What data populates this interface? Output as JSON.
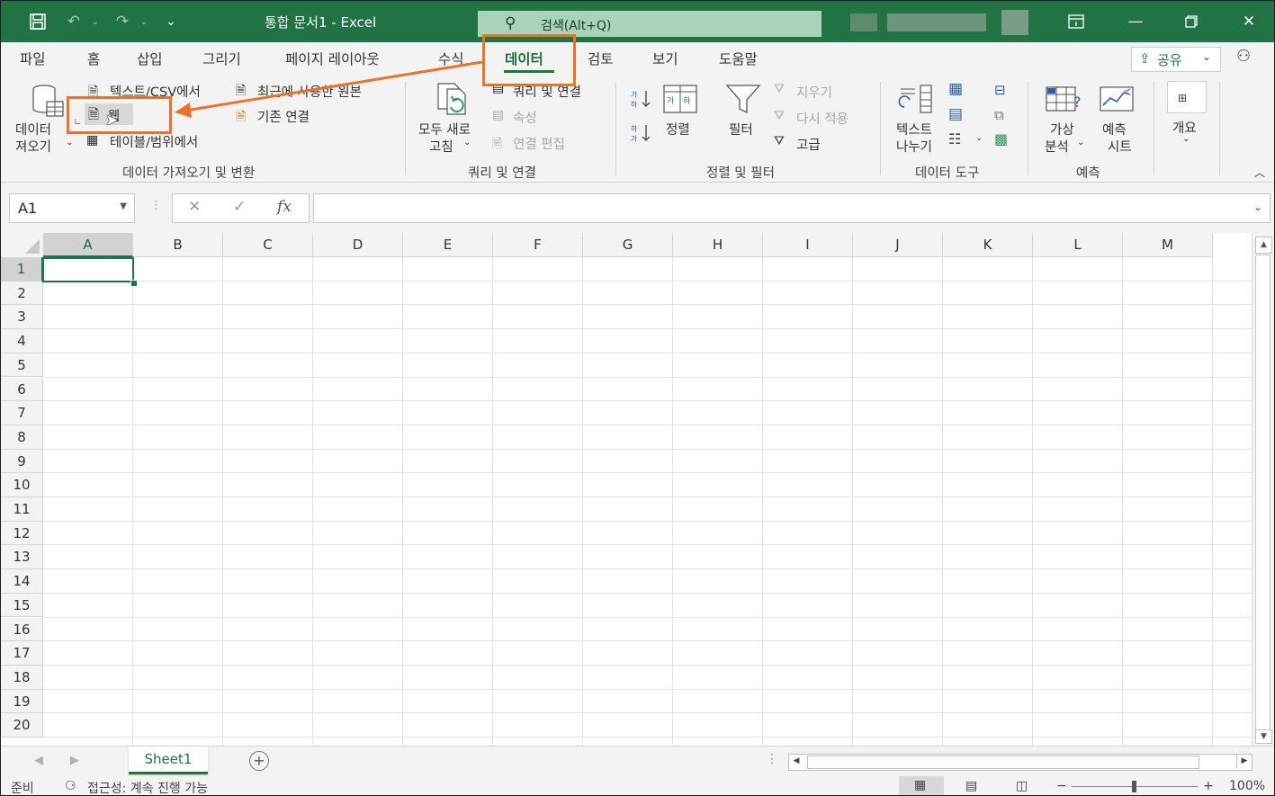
{
  "titlebar": {
    "doc_title": "통합 문서1  -  Excel",
    "search_placeholder": "검색(Alt+Q)"
  },
  "tabs": [
    "파일",
    "홈",
    "삽입",
    "그리기",
    "페이지 레이아웃",
    "수식",
    "데이터",
    "검토",
    "보기",
    "도움말"
  ],
  "active_tab": "데이터",
  "share_label": "공유",
  "ribbon": {
    "get_data": {
      "big_button": [
        "데이터",
        "져오기"
      ],
      "text_csv": "텍스트/CSV에서",
      "recent_sources": "최근에 사용한 원본",
      "web": "웹",
      "existing_conn": "기존 연결",
      "table_range": "테이블/범위에서",
      "group_label": "데이터 가져오기 및 변환"
    },
    "queries": {
      "refresh_all": [
        "모두 새로",
        "고침"
      ],
      "queries_conn": "쿼리 및 연결",
      "properties": "속성",
      "edit_links": "연결 편집",
      "group_label": "쿼리 및 연결"
    },
    "sort_filter": {
      "sort": "정렬",
      "filter": "필터",
      "clear": "지우기",
      "reapply": "다시 적용",
      "advanced": "고급",
      "group_label": "정렬 및 필터"
    },
    "data_tools": {
      "text_to_columns": [
        "텍스트",
        "나누기"
      ],
      "group_label": "데이터 도구"
    },
    "forecast": {
      "what_if": [
        "가상",
        "분석"
      ],
      "forecast_sheet": [
        "예측",
        "시트"
      ],
      "group_label": "예측"
    },
    "outline": {
      "label": "개요"
    }
  },
  "formula_bar": {
    "name_box": "A1",
    "fx": "fx",
    "value": ""
  },
  "grid": {
    "columns": [
      "A",
      "B",
      "C",
      "D",
      "E",
      "F",
      "G",
      "H",
      "I",
      "J",
      "K",
      "L",
      "M"
    ],
    "rows": [
      "1",
      "2",
      "3",
      "4",
      "5",
      "6",
      "7",
      "8",
      "9",
      "10",
      "11",
      "12",
      "13",
      "14",
      "15",
      "16",
      "17",
      "18",
      "19",
      "20"
    ],
    "active_cell": "A1"
  },
  "sheets": [
    "Sheet1"
  ],
  "status": {
    "ready": "준비",
    "accessibility": "접근성: 계속 진행 가능",
    "zoom": "100%"
  },
  "colors": {
    "excel_green": "#217346",
    "highlight": "#e8742a"
  }
}
